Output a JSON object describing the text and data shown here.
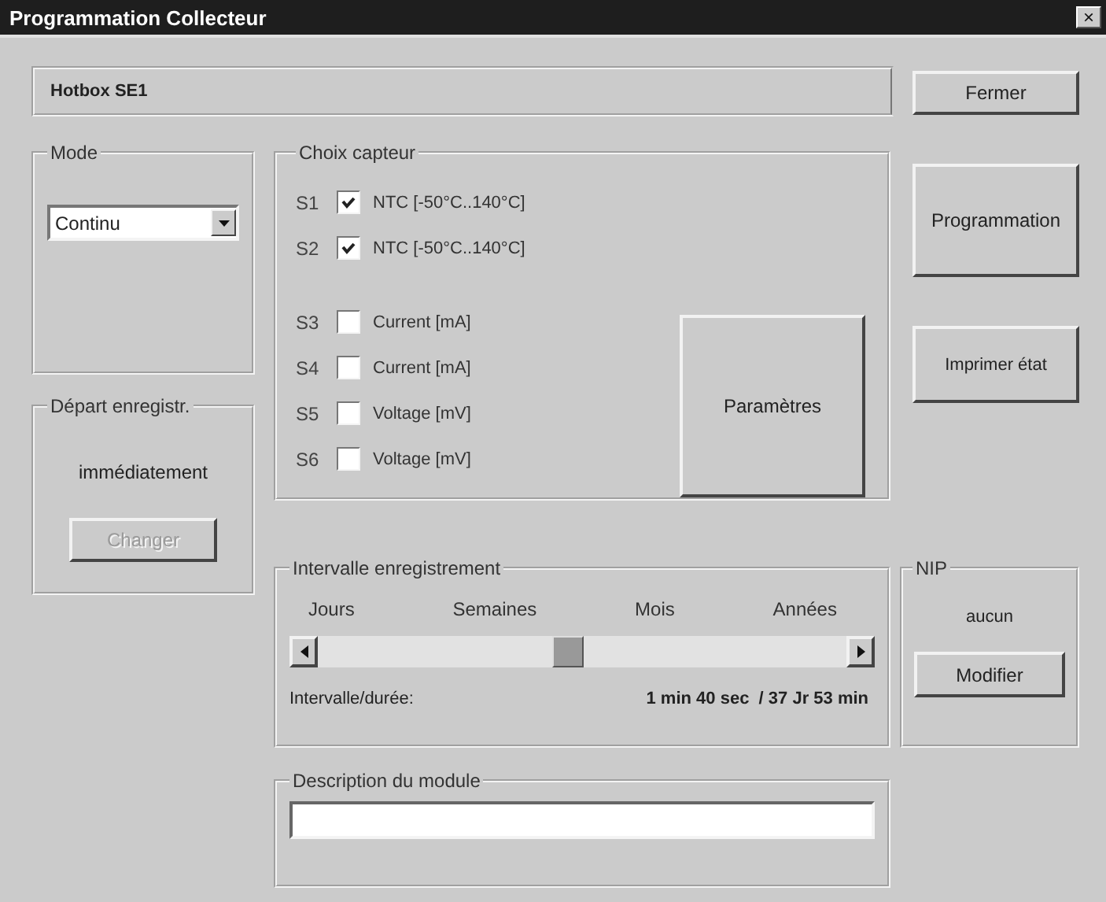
{
  "window": {
    "title": "Programmation Collecteur",
    "close": "×"
  },
  "header": {
    "label": "Hotbox SE1"
  },
  "mode": {
    "title": "Mode",
    "value": "Continu"
  },
  "start": {
    "title": "Départ enregistr.",
    "value": "immédiatement",
    "button": {
      "label": "Changer",
      "disabled": true
    }
  },
  "sensors": {
    "title": "Choix capteur",
    "items": [
      {
        "id": "S1",
        "label": "NTC [-50°C..140°C]",
        "checked": true
      },
      {
        "id": "S2",
        "label": "NTC [-50°C..140°C]",
        "checked": true
      },
      {
        "id": "S3",
        "label": "Current [mA]",
        "checked": false
      },
      {
        "id": "S4",
        "label": "Current [mA]",
        "checked": false
      },
      {
        "id": "S5",
        "label": "Voltage [mV]",
        "checked": false
      },
      {
        "id": "S6",
        "label": "Voltage [mV]",
        "checked": false
      }
    ],
    "button": "Paramètres"
  },
  "buttons": {
    "close": "Fermer",
    "program": "Programmation",
    "print": "Imprimer état"
  },
  "interval": {
    "title": "Intervalle enregistrement",
    "scale": [
      "Jours",
      "Semaines",
      "Mois",
      "Années"
    ],
    "slider": {
      "level": 0.47
    },
    "label": "Intervalle/durée:",
    "value": "1 min 40 sec  / 37 Jr 53 min"
  },
  "pin": {
    "title": "NIP",
    "value": "aucun",
    "button": "Modifier"
  },
  "description": {
    "title": "Description du module"
  }
}
